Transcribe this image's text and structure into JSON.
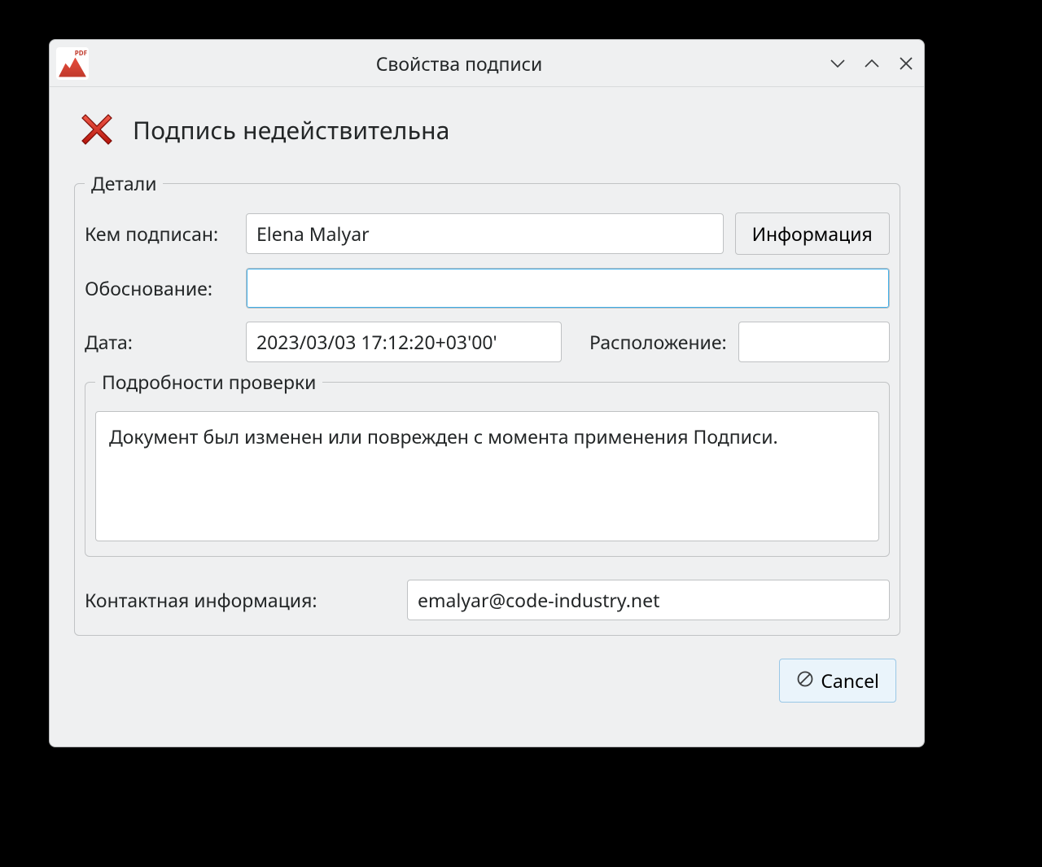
{
  "window": {
    "title": "Свойства подписи"
  },
  "status": {
    "text": "Подпись недействительна"
  },
  "details": {
    "legend": "Детали",
    "signed_by_label": "Кем подписан:",
    "signed_by_value": "Elena Malyar",
    "info_button": "Информация",
    "reason_label": "Обоснование:",
    "reason_value": "",
    "date_label": "Дата:",
    "date_value": "2023/03/03 17:12:20+03'00'",
    "location_label": "Расположение:",
    "location_value": ""
  },
  "verification": {
    "legend": "Подробности проверки",
    "message": "Документ был изменен или поврежден с момента применения Подписи."
  },
  "contact": {
    "label": "Контактная информация:",
    "value": "emalyar@code-industry.net"
  },
  "buttons": {
    "cancel": "Cancel"
  }
}
